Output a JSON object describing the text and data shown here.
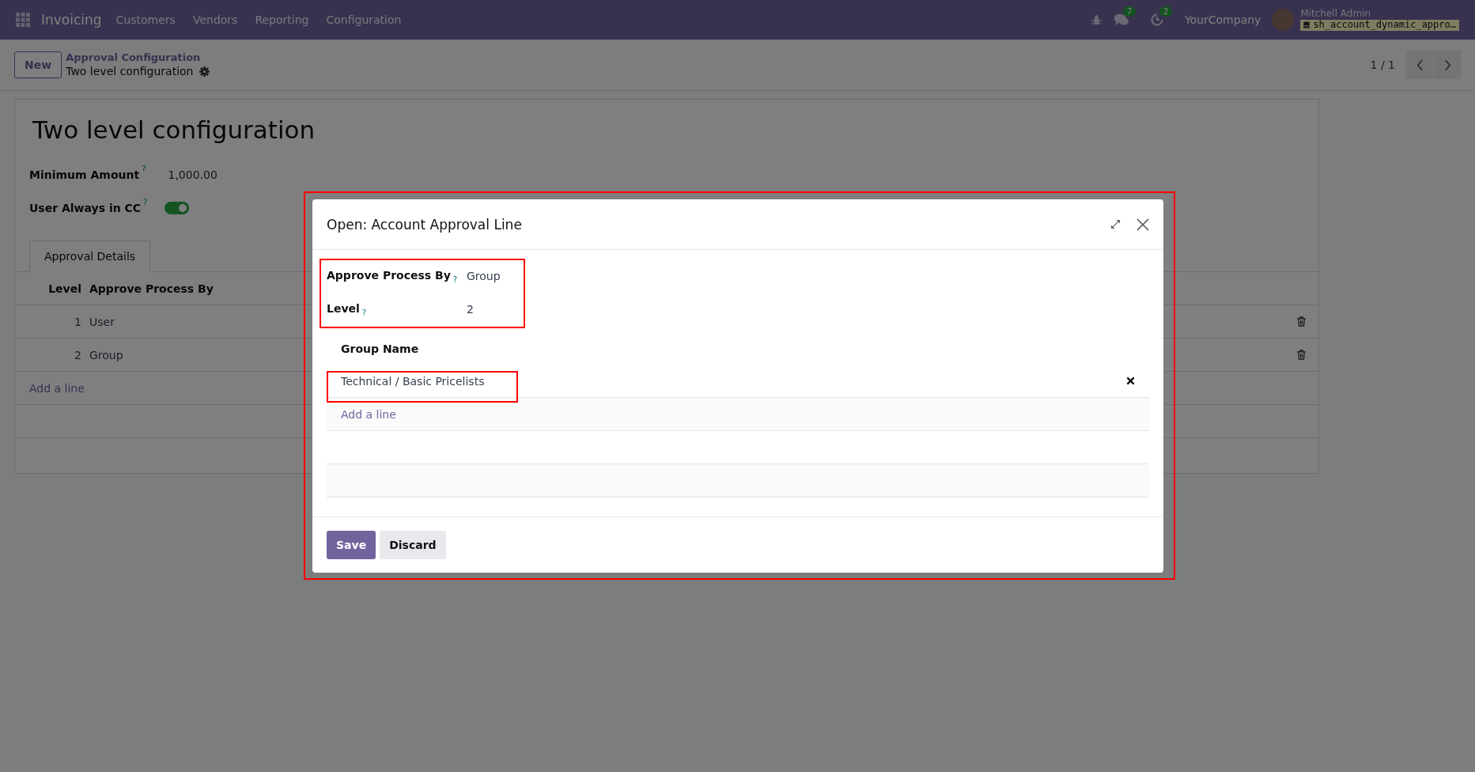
{
  "navbar": {
    "app_name": "Invoicing",
    "menu": [
      "Customers",
      "Vendors",
      "Reporting",
      "Configuration"
    ],
    "messages_badge": "7",
    "activities_badge": "2",
    "company": "YourCompany",
    "user": "Mitchell Admin",
    "database": "sh_account_dynamic_appro…"
  },
  "control_panel": {
    "new_button": "New",
    "breadcrumb": "Approval Configuration",
    "record_name": "Two level configuration",
    "pager": "1 / 1"
  },
  "form": {
    "title": "Two level configuration",
    "fields": [
      {
        "kind": "text",
        "label": "Minimum Amount",
        "help": "?",
        "value": "1,000.00"
      },
      {
        "kind": "toggle",
        "label": "User Always in CC",
        "help": "?",
        "on": true
      }
    ],
    "tabs": [
      {
        "label": "Approval Details",
        "selected": true
      }
    ],
    "table": {
      "columns": [
        "Level",
        "Approve Process By"
      ],
      "rows": [
        {
          "level": "1",
          "approve_process_by": "User"
        },
        {
          "level": "2",
          "approve_process_by": "Group"
        }
      ],
      "add_line": "Add a line"
    }
  },
  "dialog": {
    "title": "Open: Account Approval Line",
    "fields": [
      {
        "label": "Approve Process By",
        "help": "?",
        "value": "Group"
      },
      {
        "label": "Level",
        "help": "?",
        "value": "2"
      }
    ],
    "group_table": {
      "column": "Group Name",
      "rows": [
        "Technical / Basic Pricelists"
      ],
      "add_line": "Add a line"
    },
    "buttons": [
      {
        "label": "Save",
        "kind": "primary"
      },
      {
        "label": "Discard",
        "kind": "secondary"
      }
    ]
  }
}
